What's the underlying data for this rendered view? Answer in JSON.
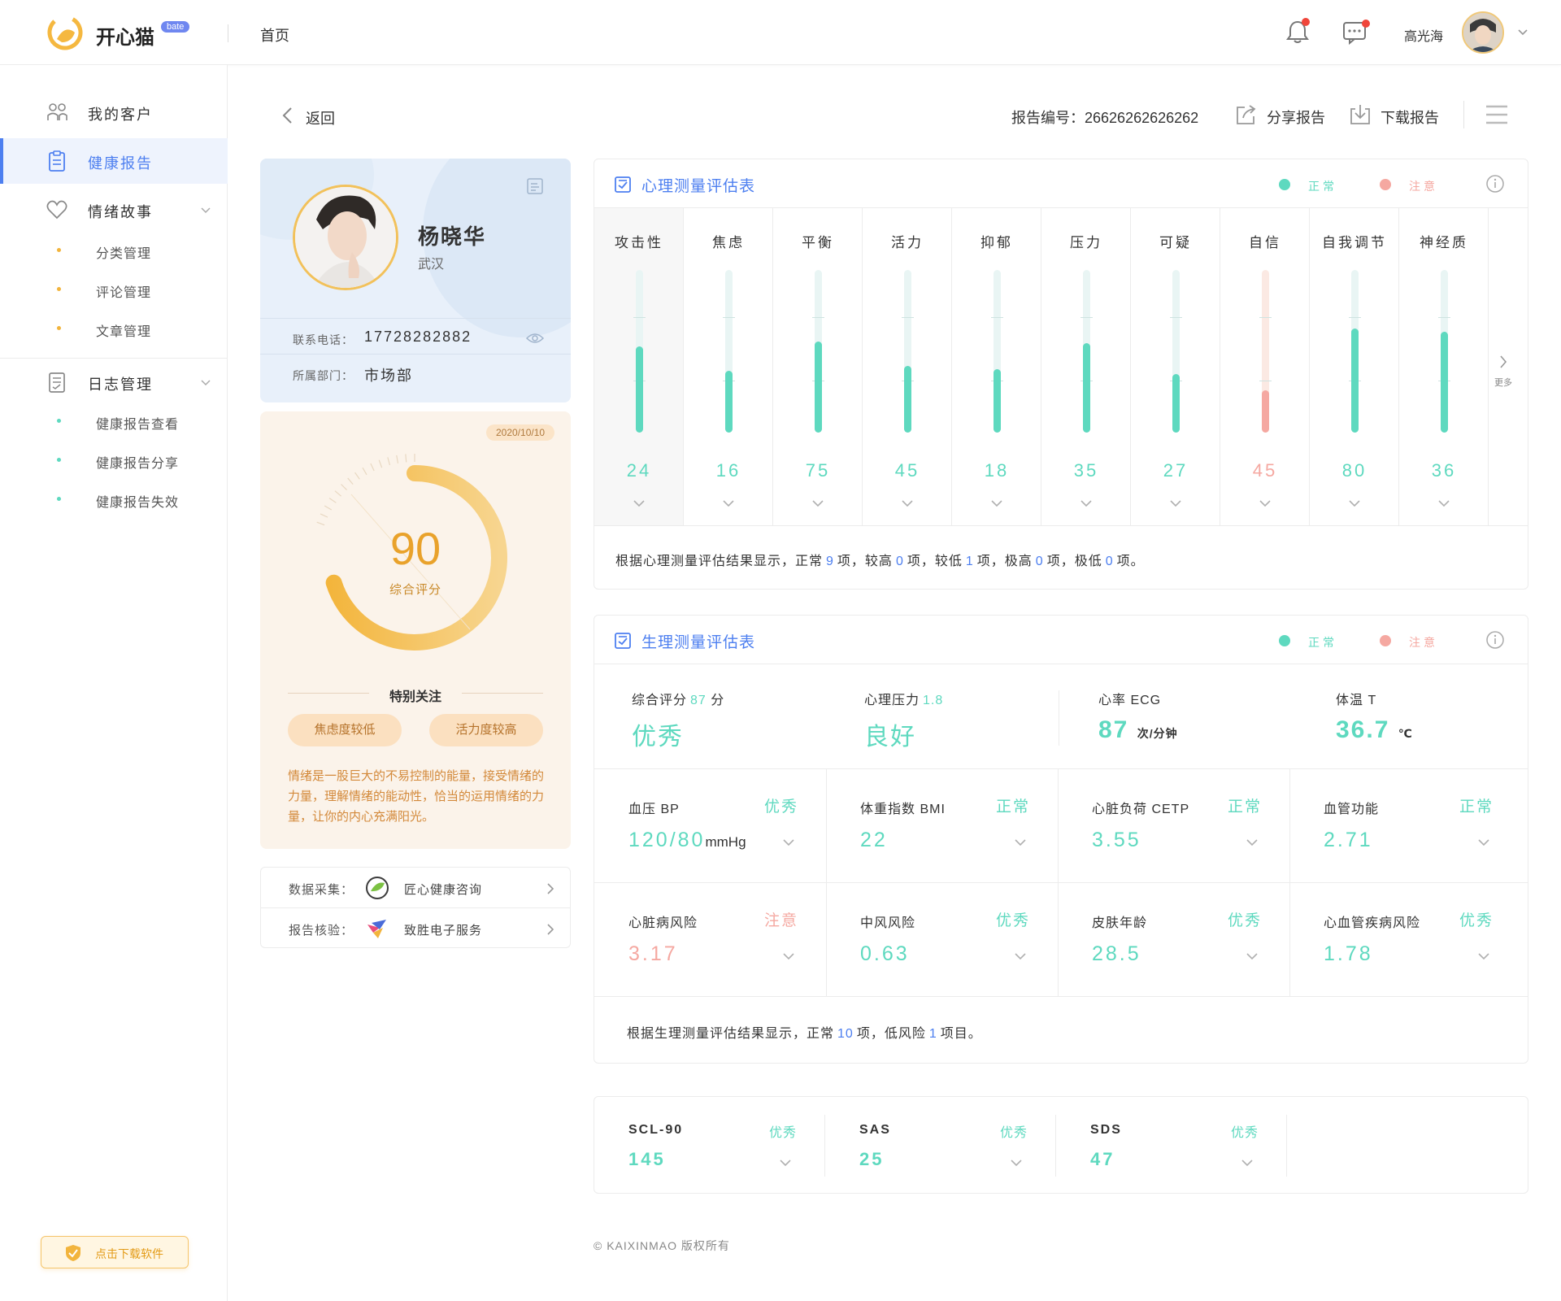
{
  "header": {
    "brand": "开心猫",
    "beta": "bate",
    "home": "首页",
    "username": "高光海"
  },
  "sidebar": {
    "items": [
      {
        "label": "我的客户",
        "icon": "users-icon"
      },
      {
        "label": "健康报告",
        "icon": "clipboard-icon",
        "active": true
      },
      {
        "label": "情绪故事",
        "icon": "heart-icon"
      },
      {
        "label": "日志管理",
        "icon": "log-icon"
      }
    ],
    "story_subitems": [
      "分类管理",
      "评论管理",
      "文章管理"
    ],
    "log_subitems": [
      "健康报告查看",
      "健康报告分享",
      "健康报告失效"
    ],
    "download_label": "点击下载软件"
  },
  "topbar": {
    "back": "返回",
    "report_no": "报告编号：26626262626262",
    "share": "分享报告",
    "download": "下载报告"
  },
  "profile": {
    "name": "杨晓华",
    "city": "武汉",
    "phone_label": "联系电话：",
    "phone": "17728282882",
    "dept_label": "所属部门：",
    "dept": "市场部"
  },
  "score": {
    "date": "2020/10/10",
    "value": "90",
    "label": "综合评分",
    "attention_title": "特别关注",
    "tags": [
      "焦虑度较低",
      "活力度较高"
    ],
    "description": "情绪是一股巨大的不易控制的能量，接受情绪的力量，理解情绪的能动性，恰当的运用情绪的力量，让你的内心充满阳光。"
  },
  "sources": [
    {
      "label": "数据采集：",
      "value": "匠心健康咨询"
    },
    {
      "label": "报告核验：",
      "value": "致胜电子服务"
    }
  ],
  "colors": {
    "accent": "#4d7ff0",
    "normal": "#5ed9bf",
    "attention": "#f5a8a1",
    "gold": "#f2b43c"
  },
  "psych": {
    "title": "心理测量评估表",
    "legend_normal": "正常",
    "legend_attention": "注意",
    "more": "更多",
    "items": [
      {
        "name": "攻击性",
        "value": 24,
        "level": 0.53,
        "status": "normal"
      },
      {
        "name": "焦虑",
        "value": 16,
        "level": 0.38,
        "status": "normal"
      },
      {
        "name": "平衡",
        "value": 75,
        "level": 0.56,
        "status": "normal"
      },
      {
        "name": "活力",
        "value": 45,
        "level": 0.41,
        "status": "normal"
      },
      {
        "name": "抑郁",
        "value": 18,
        "level": 0.39,
        "status": "normal"
      },
      {
        "name": "压力",
        "value": 35,
        "level": 0.55,
        "status": "normal"
      },
      {
        "name": "可疑",
        "value": 27,
        "level": 0.36,
        "status": "normal"
      },
      {
        "name": "自信",
        "value": 45,
        "level": 0.26,
        "status": "attention"
      },
      {
        "name": "自我调节",
        "value": 80,
        "level": 0.64,
        "status": "normal"
      },
      {
        "name": "神经质",
        "value": 36,
        "level": 0.62,
        "status": "normal"
      }
    ],
    "summary": {
      "prefix": "根据心理测量评估结果显示，正常",
      "normal": "9",
      "t1": "项，较高",
      "high": "0",
      "t2": "项，较低",
      "low": "1",
      "t3": "项，极高",
      "very_high": "0",
      "t4": "项，极低",
      "very_low": "0",
      "t5": "项。"
    }
  },
  "physio": {
    "title": "生理测量评估表",
    "legend_normal": "正常",
    "legend_attention": "注意",
    "top": [
      {
        "label": "综合评分",
        "num": "87",
        "suffix": "分",
        "big": "优秀"
      },
      {
        "label": "心理压力",
        "num": "1.8",
        "suffix": "",
        "big": "良好"
      },
      {
        "label": "心率 ECG",
        "num": "",
        "suffix": "",
        "big": "87",
        "unit": "次/分钟"
      },
      {
        "label": "体温 T",
        "num": "",
        "suffix": "",
        "big": "36.7",
        "unit": "℃"
      }
    ],
    "cells": [
      {
        "label": "血压  BP",
        "status": "优秀",
        "value": "120/80",
        "unit": "mmHg",
        "kind": "normal"
      },
      {
        "label": "体重指数  BMI",
        "status": "正常",
        "value": "22",
        "unit": "",
        "kind": "normal"
      },
      {
        "label": "心脏负荷  CETP",
        "status": "正常",
        "value": "3.55",
        "unit": "",
        "kind": "normal"
      },
      {
        "label": "血管功能",
        "status": "正常",
        "value": "2.71",
        "unit": "",
        "kind": "normal"
      },
      {
        "label": "心脏病风险",
        "status": "注意",
        "value": "3.17",
        "unit": "",
        "kind": "attention"
      },
      {
        "label": "中风风险",
        "status": "优秀",
        "value": "0.63",
        "unit": "",
        "kind": "normal"
      },
      {
        "label": "皮肤年龄",
        "status": "优秀",
        "value": "28.5",
        "unit": "",
        "kind": "normal"
      },
      {
        "label": "心血管疾病风险",
        "status": "优秀",
        "value": "1.78",
        "unit": "",
        "kind": "normal"
      }
    ],
    "summary": {
      "prefix": "根据生理测量评估结果显示，正常",
      "normal": "10",
      "t1": "项，低风险",
      "low_risk": "1",
      "t2": "项目。"
    }
  },
  "scales": [
    {
      "label": "SCL-90",
      "status": "优秀",
      "value": "145"
    },
    {
      "label": "SAS",
      "status": "优秀",
      "value": "25"
    },
    {
      "label": "SDS",
      "status": "优秀",
      "value": "47"
    }
  ],
  "footer": {
    "copyright": "© KAIXINMAO 版权所有"
  }
}
